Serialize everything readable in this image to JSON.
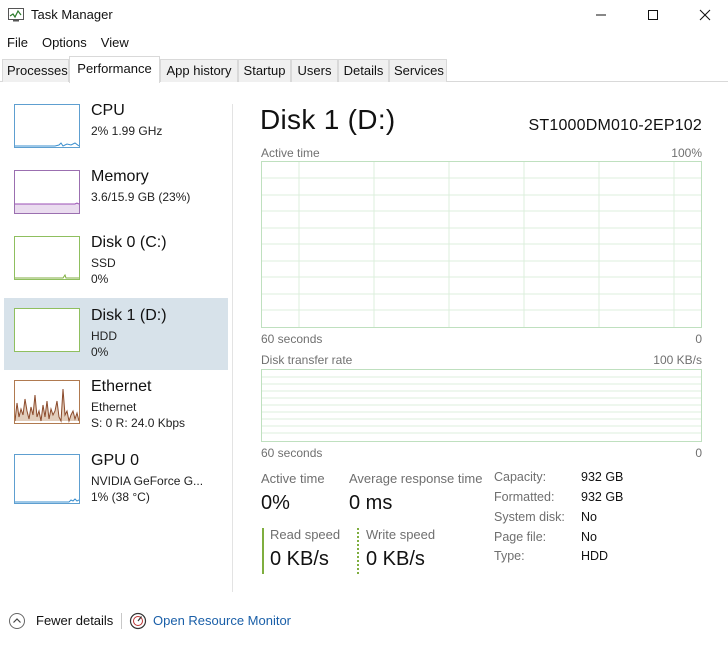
{
  "window": {
    "title": "Task Manager"
  },
  "menu": [
    "File",
    "Options",
    "View"
  ],
  "tabs": [
    "Processes",
    "Performance",
    "App history",
    "Startup",
    "Users",
    "Details",
    "Services"
  ],
  "active_tab": "Performance",
  "sidebar": {
    "items": [
      {
        "name": "CPU",
        "line1": "2% 1.99 GHz",
        "line2": ""
      },
      {
        "name": "Memory",
        "line1": "3.6/15.9 GB (23%)",
        "line2": ""
      },
      {
        "name": "Disk 0 (C:)",
        "line1": "SSD",
        "line2": "0%"
      },
      {
        "name": "Disk 1 (D:)",
        "line1": "HDD",
        "line2": "0%",
        "selected": true
      },
      {
        "name": "Ethernet",
        "line1": "Ethernet",
        "line2": "S: 0 R: 24.0 Kbps"
      },
      {
        "name": "GPU 0",
        "line1": "NVIDIA GeForce G...",
        "line2": "1% (38 °C)"
      }
    ]
  },
  "main": {
    "title": "Disk 1 (D:)",
    "model": "ST1000DM010-2EP102",
    "chart1": {
      "label": "Active time",
      "max_label": "100%",
      "x_label": "60 seconds",
      "min_label": "0"
    },
    "chart2": {
      "label": "Disk transfer rate",
      "max_label": "100 KB/s",
      "x_label": "60 seconds",
      "min_label": "0"
    },
    "stats": {
      "active_time_label": "Active time",
      "active_time_value": "0%",
      "avg_response_label": "Average response time",
      "avg_response_value": "0 ms",
      "read_speed_label": "Read speed",
      "read_speed_value": "0 KB/s",
      "write_speed_label": "Write speed",
      "write_speed_value": "0 KB/s"
    },
    "properties": [
      {
        "key": "Capacity:",
        "value": "932 GB"
      },
      {
        "key": "Formatted:",
        "value": "932 GB"
      },
      {
        "key": "System disk:",
        "value": "No"
      },
      {
        "key": "Page file:",
        "value": "No"
      },
      {
        "key": "Type:",
        "value": "HDD"
      }
    ]
  },
  "footer": {
    "fewer_details": "Fewer details",
    "open_monitor": "Open Resource Monitor"
  },
  "colors": {
    "chart_grid": "#d8ecd8",
    "chart_border": "#bfe0bf",
    "disk_accent": "#7fae3f",
    "cpu_accent": "#3a8fcf",
    "memory_accent": "#9b4fb5",
    "ethernet_accent": "#a0522d",
    "selected_bg": "#d7e2ea",
    "link": "#1a5fa8"
  }
}
